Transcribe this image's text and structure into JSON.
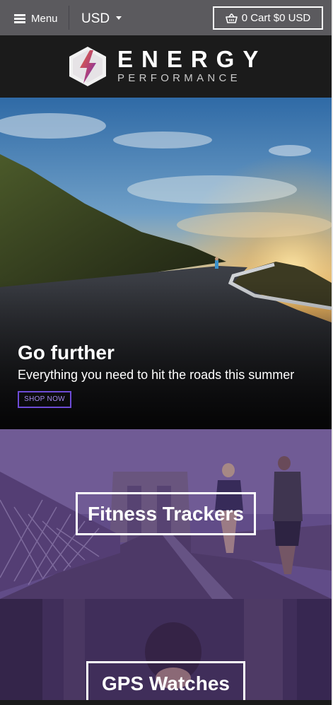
{
  "header": {
    "menu_label": "Menu",
    "currency": "USD",
    "cart_label": "0 Cart $0 USD"
  },
  "logo": {
    "wordmark": "ENERGY",
    "tagline": "PERFORMANCE"
  },
  "hero": {
    "title": "Go further",
    "subtitle": "Everything you need to hit the roads this summer",
    "button_label": "SHOP NOW"
  },
  "collections": [
    {
      "label": "Fitness Trackers"
    },
    {
      "label": "GPS Watches"
    }
  ],
  "colors": {
    "topbar": "#5b5a5e",
    "accent_purple": "#6d4bd6",
    "dark": "#1b1b1b"
  },
  "icons": {
    "menu": "hamburger-icon",
    "currency_caret": "caret-down-icon",
    "cart": "basket-icon",
    "logo": "energy-hexagon-logo"
  }
}
